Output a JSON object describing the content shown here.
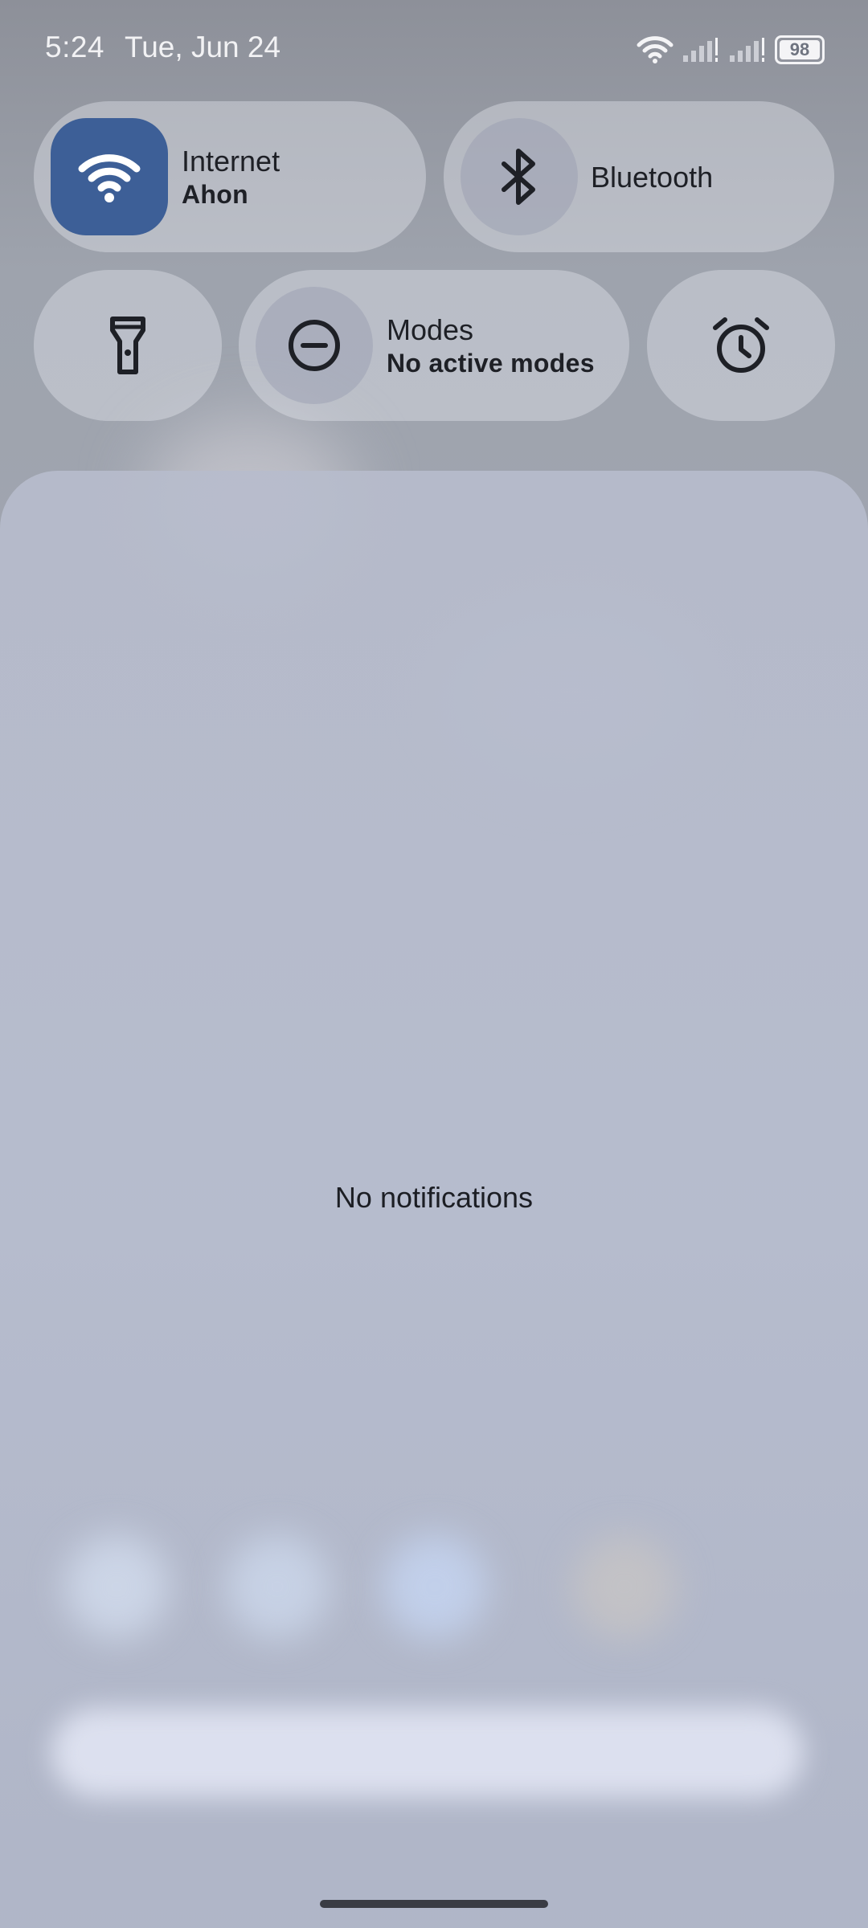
{
  "status_bar": {
    "time": "5:24",
    "date": "Tue, Jun 24",
    "battery": "98",
    "icons": [
      "wifi-icon",
      "signal-icon",
      "signal-icon",
      "battery-icon"
    ]
  },
  "quick_settings": {
    "internet": {
      "title": "Internet",
      "subtitle": "Ahon",
      "icon": "wifi-icon",
      "state": "on",
      "accent": "#3d5f97"
    },
    "bluetooth": {
      "title": "Bluetooth",
      "icon": "bluetooth-icon",
      "state": "off"
    },
    "flashlight": {
      "icon": "flashlight-icon",
      "state": "off"
    },
    "modes": {
      "title": "Modes",
      "subtitle": "No active modes",
      "icon": "do-not-disturb-icon",
      "state": "off"
    },
    "alarm": {
      "icon": "alarm-icon"
    }
  },
  "notifications": {
    "empty_text": "No notifications"
  }
}
